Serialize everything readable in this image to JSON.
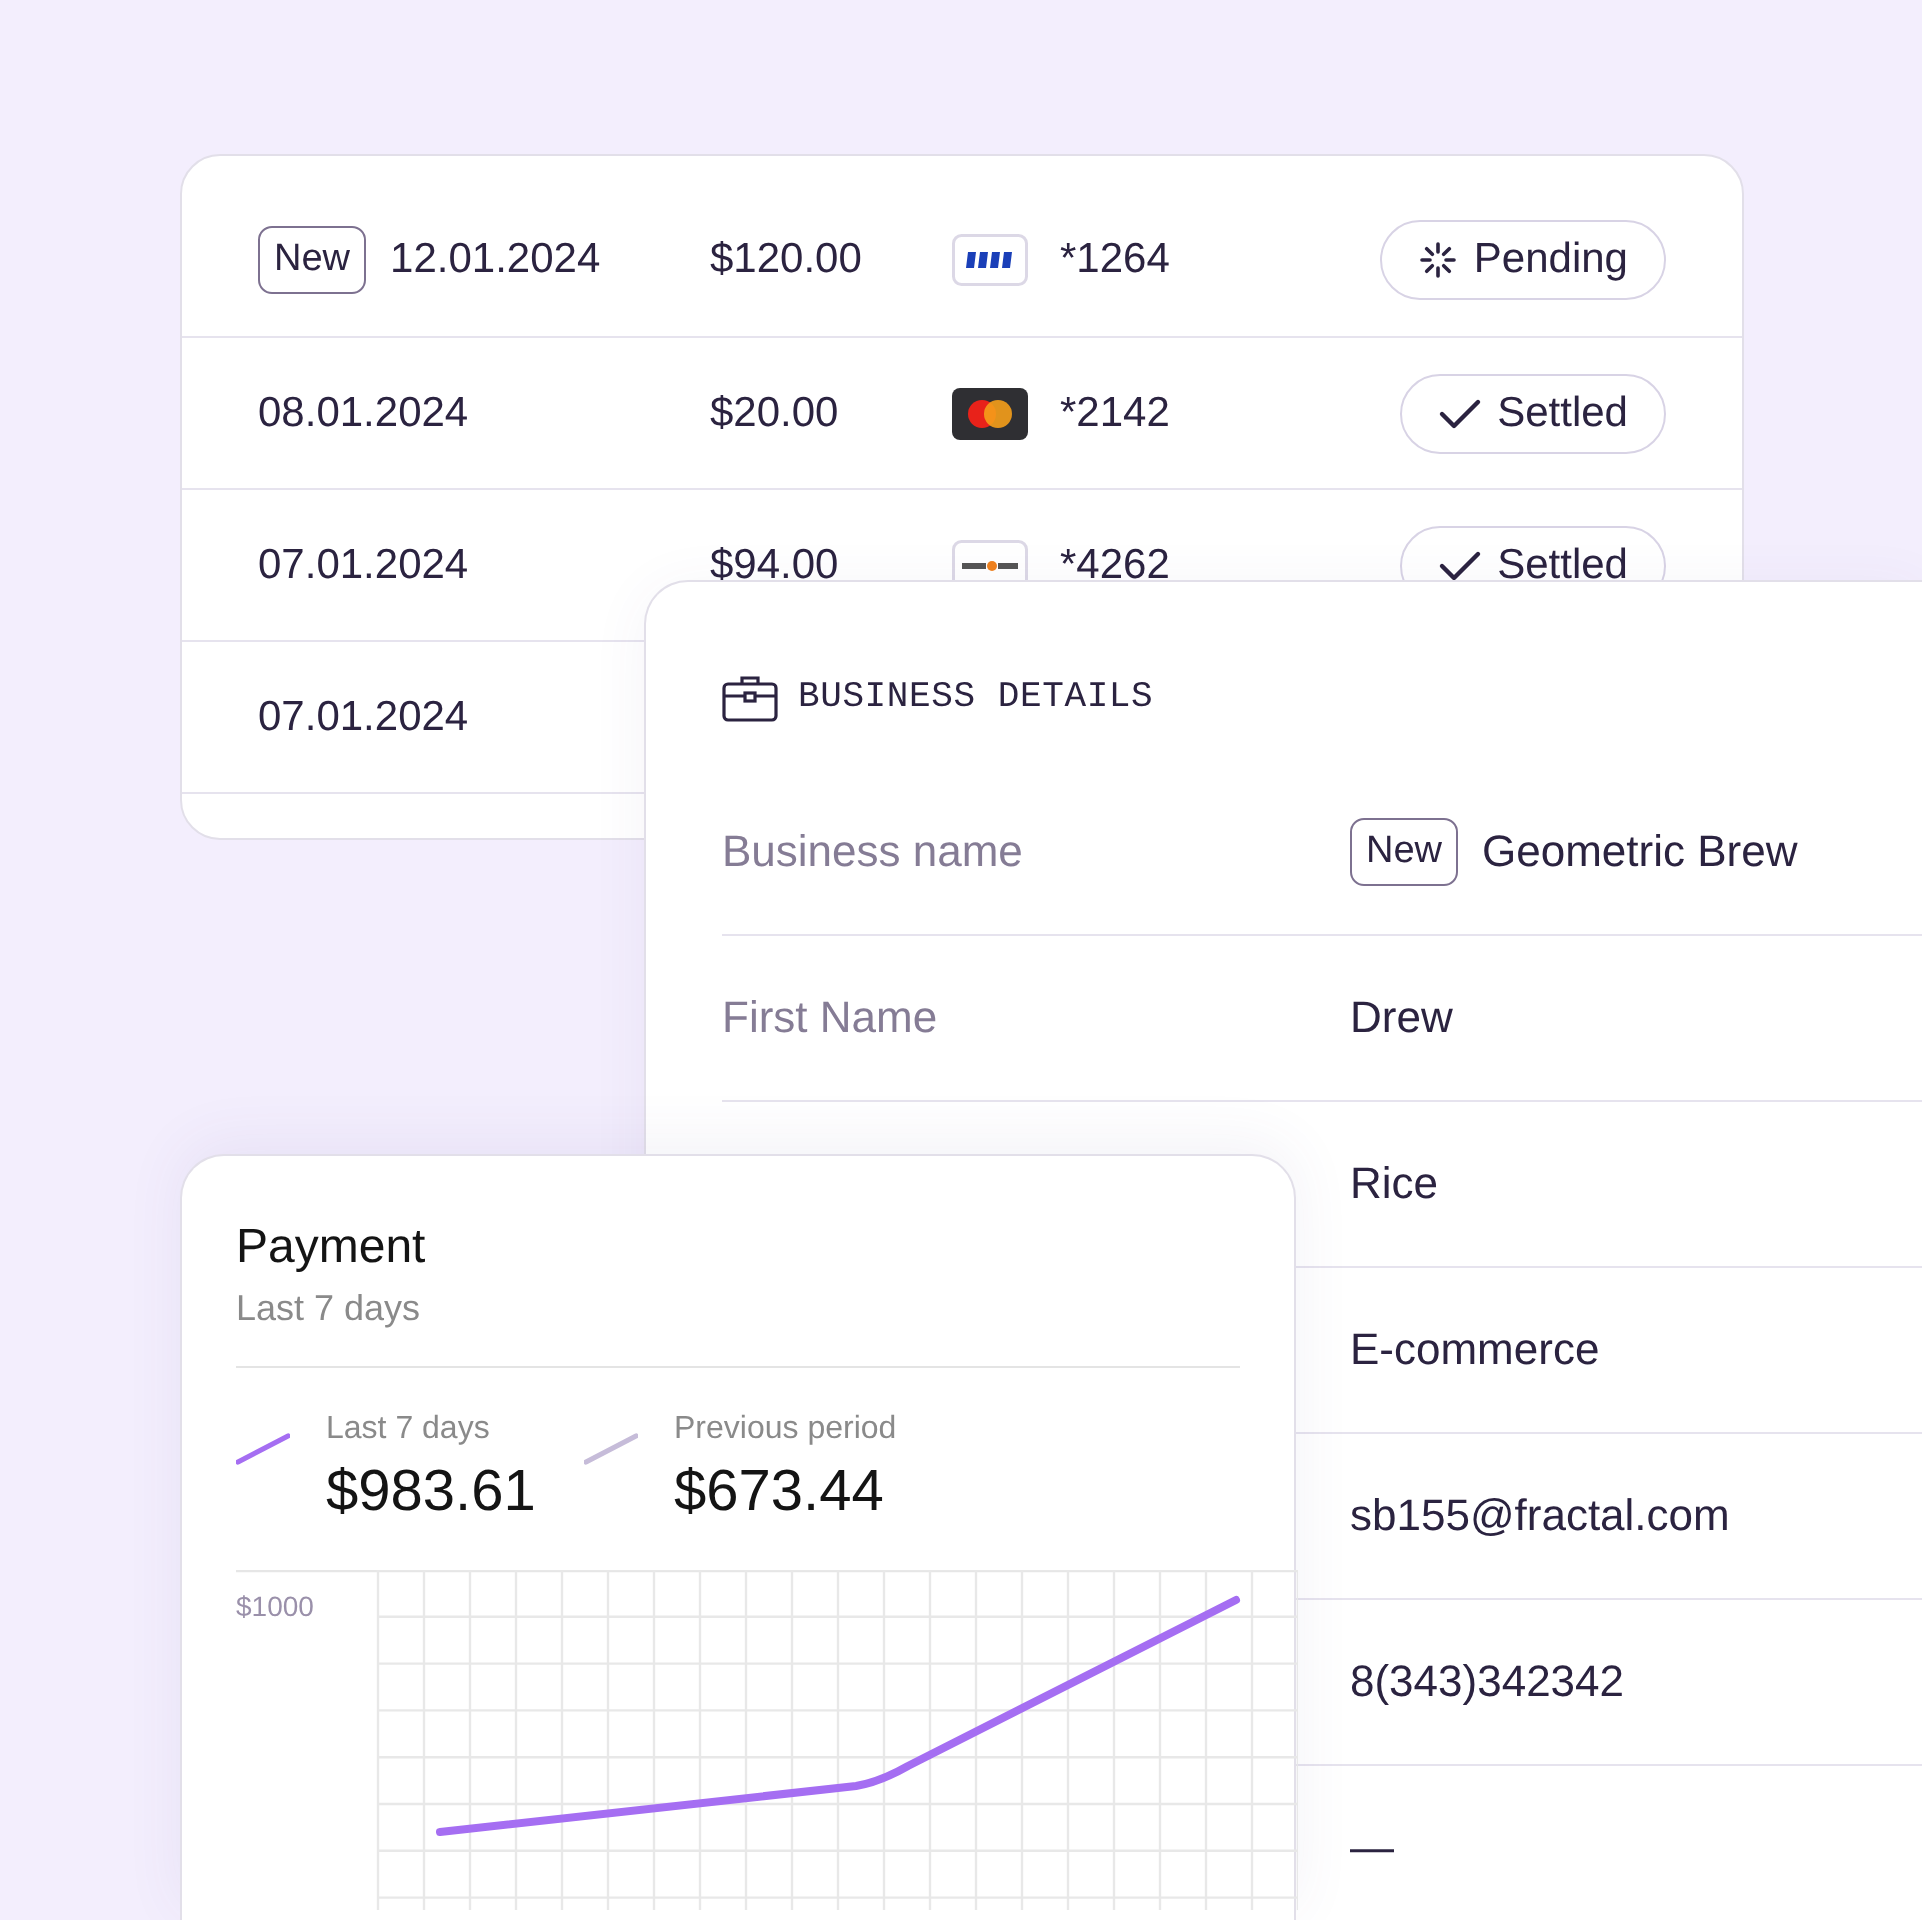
{
  "transactions": {
    "rows": [
      {
        "badge": "New",
        "date": "12.01.2024",
        "amount": "$120.00",
        "card": {
          "kind": "visa",
          "number": "*1264"
        },
        "status": {
          "label": "Pending",
          "kind": "pending"
        }
      },
      {
        "date": "08.01.2024",
        "amount": "$20.00",
        "card": {
          "kind": "mastercard",
          "number": "*2142"
        },
        "status": {
          "label": "Settled",
          "kind": "settled"
        }
      },
      {
        "date": "07.01.2024",
        "amount": "$94.00",
        "card": {
          "kind": "discover",
          "number": "*4262"
        },
        "status": {
          "label": "Settled",
          "kind": "settled"
        }
      },
      {
        "date": "07.01.2024"
      },
      {}
    ]
  },
  "business_details": {
    "title": "BUSINESS DETAILS",
    "rows": [
      {
        "label": "Business name",
        "badge": "New",
        "value": "Geometric Brew"
      },
      {
        "label": "First Name",
        "value": "Drew"
      },
      {
        "value": "Rice"
      },
      {
        "value": "E-commerce"
      },
      {
        "value": "sb155@fractal.com"
      },
      {
        "value": "8(343)342342"
      },
      {
        "value": "—"
      }
    ]
  },
  "payment": {
    "title": "Payment",
    "subtitle": "Last 7 days",
    "legend": [
      {
        "label": "Last 7 days",
        "value": "$983.61",
        "color": "#a56ef2"
      },
      {
        "label": "Previous period",
        "value": "$673.44",
        "color": "#c6bcd9"
      }
    ],
    "chart": {
      "y_label": "$1000"
    }
  }
}
